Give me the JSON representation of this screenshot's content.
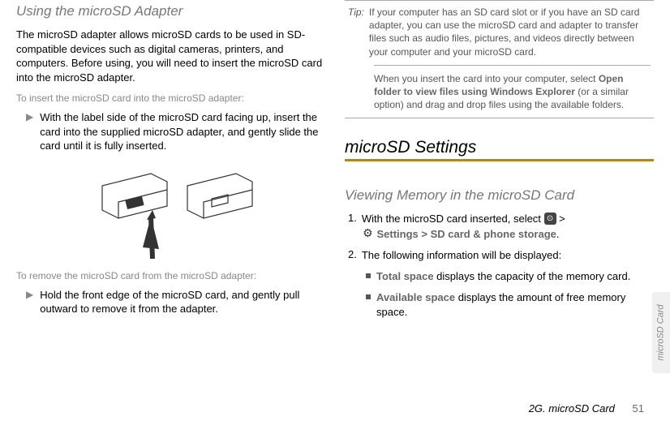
{
  "left": {
    "heading": "Using the microSD Adapter",
    "intro": "The microSD adapter allows microSD cards to be used in SD-compatible devices such as digital cameras, printers, and computers. Before using, you will need to insert the microSD card into the microSD adapter.",
    "insertLabel": "To insert the microSD card into the microSD adapter:",
    "insertBullet": "With the label side of the microSD card facing up, insert the card into the supplied microSD adapter, and gently slide the card until it is fully inserted.",
    "removeLabel": "To remove the microSD card from the microSD adapter:",
    "removeBullet": "Hold the front edge of the microSD card, and gently pull outward to remove it from the adapter."
  },
  "right": {
    "tipLabel": "Tip:",
    "tipText1": "If your computer has an SD card slot or if you have an SD card adapter, you can use the microSD card and adapter to transfer files such as audio files, pictures, and videos directly between your computer and your microSD card.",
    "tipText2a": "When you insert the card into your computer, select ",
    "tipBold": "Open folder to view files using Windows Explorer",
    "tipText2b": " (or a similar option) and drag and drop files using the available folders.",
    "sectionHeading": "microSD Settings",
    "subHeading": "Viewing Memory in the microSD Card",
    "step1a": "With the microSD card inserted, select ",
    "step1b": " > ",
    "step1Settings": "Settings > SD card & phone storage",
    "step1c": ".",
    "step2": "The following information will be displayed:",
    "totalBold": "Total space",
    "totalText": " displays the capacity of the memory card.",
    "availBold": "Available space",
    "availText": " displays the amount of free memory space."
  },
  "sideTab": "microSD Card",
  "footerSection": "2G. microSD Card",
  "footerPage": "51"
}
